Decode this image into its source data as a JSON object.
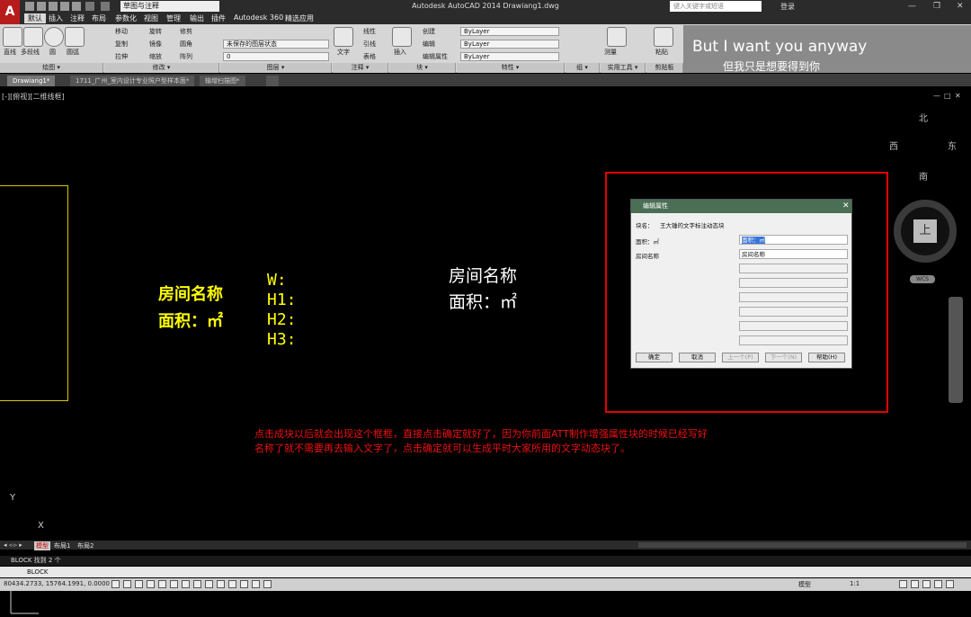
{
  "app": {
    "logo": "A",
    "title": "Autodesk AutoCAD 2014    Drawiang1.dwg",
    "workspace": "草图与注释",
    "search_placeholder": "键入关键字或短语",
    "login": "登录"
  },
  "menu": [
    "默认",
    "插入",
    "注释",
    "布局",
    "参数化",
    "视图",
    "管理",
    "输出",
    "插件",
    "Autodesk 360",
    "精选应用"
  ],
  "ribbon": {
    "draw": {
      "line": "直线",
      "polyline": "多段线",
      "circle": "圆",
      "arc": "圆弧",
      "panel": "绘图 ▾"
    },
    "modify": {
      "move": "移动",
      "rotate": "旋转",
      "trim": "修剪",
      "copy": "复制",
      "mirror": "镜像",
      "fillet": "圆角",
      "stretch": "拉伸",
      "scale": "缩放",
      "array": "阵列",
      "panel": "修改 ▾"
    },
    "layers": {
      "state": "未保存的图层状态",
      "current": "0",
      "panel": "图层 ▾"
    },
    "annotation": {
      "text": "文字",
      "linear": "线性",
      "leader": "引线",
      "table": "表格",
      "panel": "注释 ▾"
    },
    "block": {
      "insert": "插入",
      "create": "创建",
      "edit": "编辑",
      "attr": "编辑属性",
      "panel": "块 ▾"
    },
    "properties": {
      "color": "ByLayer",
      "linetype": "ByLayer",
      "lineweight": "ByLayer",
      "panel": "特性 ▾"
    },
    "groups": {
      "panel": "组 ▾"
    },
    "utilities": {
      "measure": "测量",
      "panel": "实用工具 ▾"
    },
    "clipboard": {
      "paste": "粘贴",
      "panel": "剪贴板"
    }
  },
  "watermark": {
    "line1": "But I want you anyway",
    "line2": "但我只是想要得到你"
  },
  "tabs": [
    "Drawiang1*",
    "1711_广州_室内设计专业照户型样本面*",
    "输增扫描图*"
  ],
  "canvas": {
    "view_label": "[-][俯视][二维线框]",
    "viewport_controls": [
      "—",
      "□",
      "✕"
    ],
    "room_name": "房间名称",
    "area_label": "面积：㎡",
    "wh": [
      "W:",
      "H1:",
      "H2:",
      "H3:"
    ],
    "room_name_white": "房间名称",
    "area_label_white": "面积：㎡",
    "ucs_y": "Y",
    "ucs_x": "X"
  },
  "dialog": {
    "title": "编辑属性",
    "block_name_label": "块名：",
    "block_name": "王大锤的文字标注动态块",
    "area_label": "面积：㎡",
    "area_value": "面积：㎡",
    "room_label": "房间名称",
    "room_value": "房间名称",
    "ok": "确定",
    "cancel": "取消",
    "prev": "上一个(P)",
    "next": "下一个(N)",
    "help": "帮助(H)"
  },
  "note": {
    "line1": "点击成块以后就会出现这个框框，直接点击确定就好了，因为你前面ATT制作增强属性块的时候已经写好",
    "line2": "名称了就不需要再去输入文字了，点击确定就可以生成平时大家所用的文字动态块了。"
  },
  "compass": {
    "north": "北",
    "south": "南",
    "east": "东",
    "west": "西",
    "top": "上",
    "wcs": "WCS"
  },
  "layouts": [
    "模型",
    "布局1",
    "布局2"
  ],
  "command": {
    "history": "BLOCK 找到 2 个",
    "prompt": "BLOCK"
  },
  "status": {
    "coords": "80434.2733, 15764.1991, 0.0000",
    "model": "模型",
    "scale": "1:1"
  }
}
